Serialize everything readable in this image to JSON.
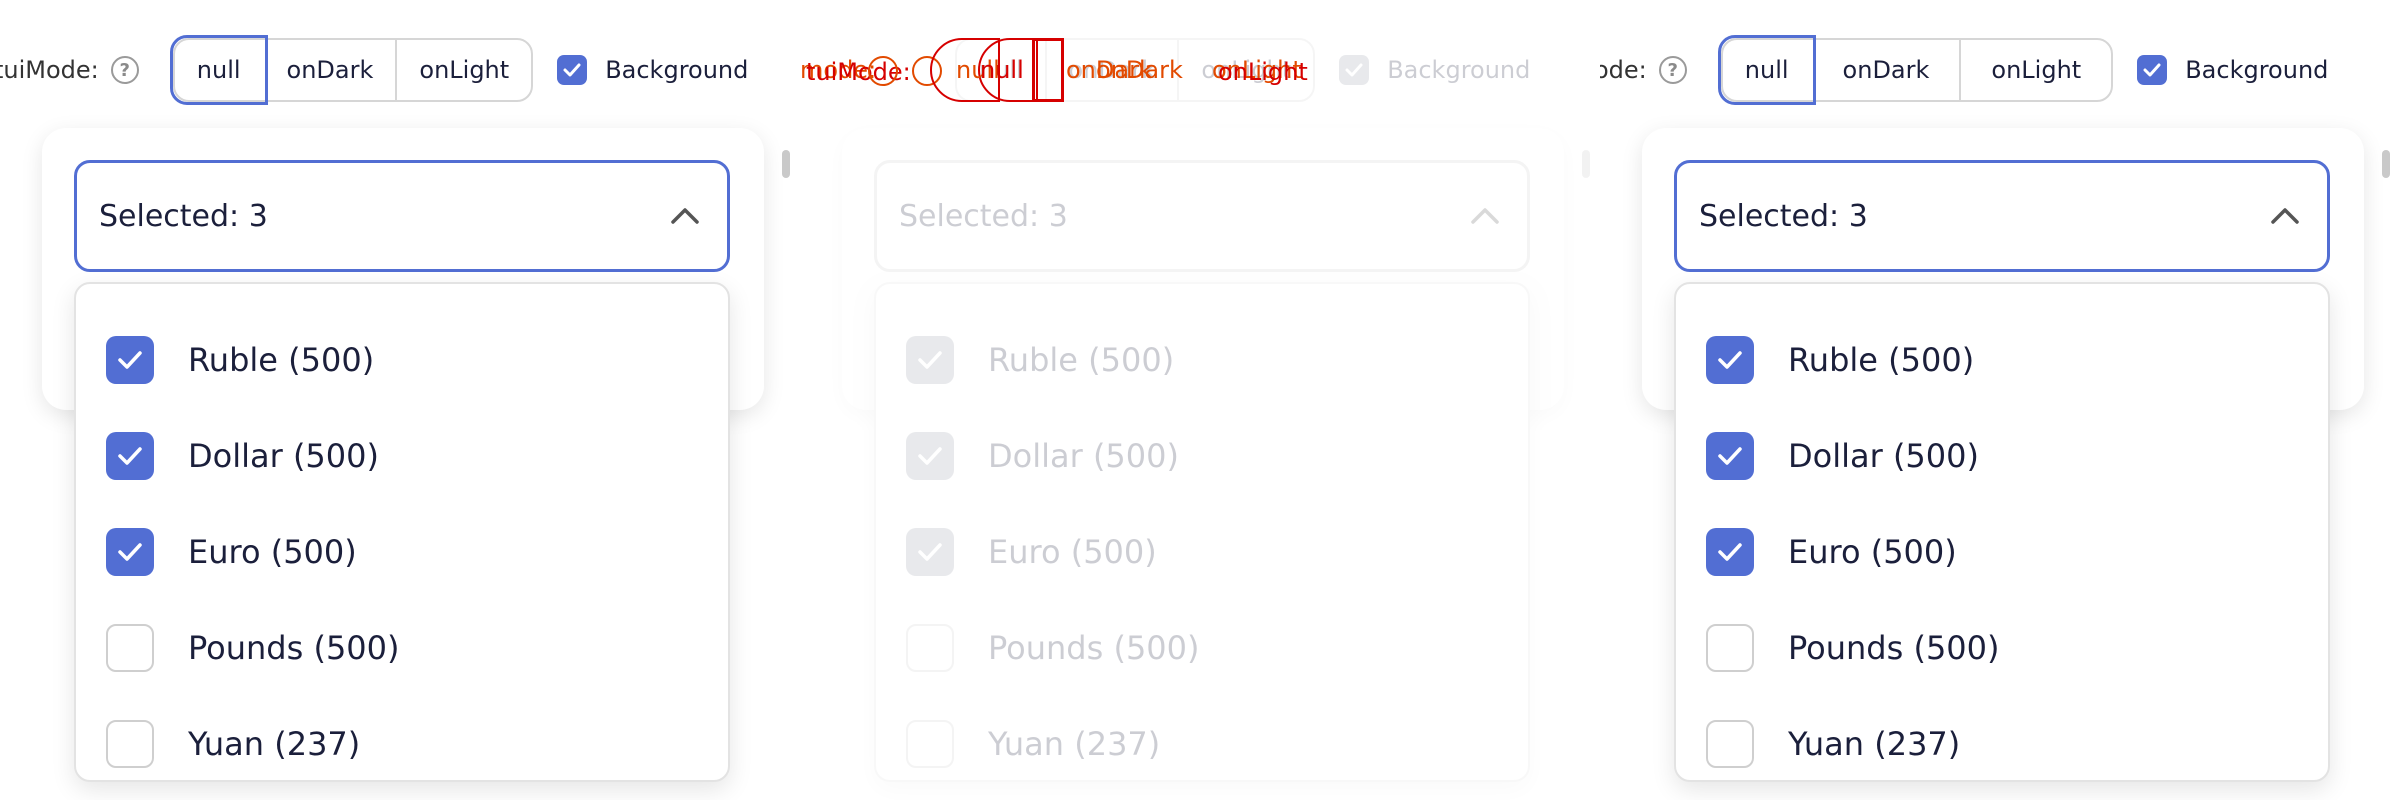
{
  "toolbar": {
    "mode_label_left": "tuiMode:",
    "mode_label_right": "ode:",
    "help_symbol": "?",
    "segments": [
      "null",
      "onDark",
      "onLight"
    ],
    "active_segment": "null",
    "background_label": "Background"
  },
  "overlay": {
    "text_a": "mode:",
    "text_b": "tuiMode:",
    "text_c": "null",
    "text_d": "null",
    "text_e": "onDark",
    "text_f": "onDark",
    "text_g": "onLight",
    "text_h": "onLight",
    "text_i": "?"
  },
  "select": {
    "value": "Selected: 3"
  },
  "options": [
    {
      "label": "Ruble (500)",
      "checked": true
    },
    {
      "label": "Dollar (500)",
      "checked": true
    },
    {
      "label": "Euro (500)",
      "checked": true
    },
    {
      "label": "Pounds (500)",
      "checked": false
    },
    {
      "label": "Yuan (237)",
      "checked": false
    }
  ],
  "colors": {
    "accent": "#526ed3",
    "border": "#d6d6d6",
    "text": "#1b1f3b",
    "debug_red": "#d60000",
    "debug_orange": "#e24a00"
  },
  "icons": {
    "help": "question-circle-icon",
    "check": "checkmark-icon",
    "chevron": "chevron-up-icon"
  }
}
